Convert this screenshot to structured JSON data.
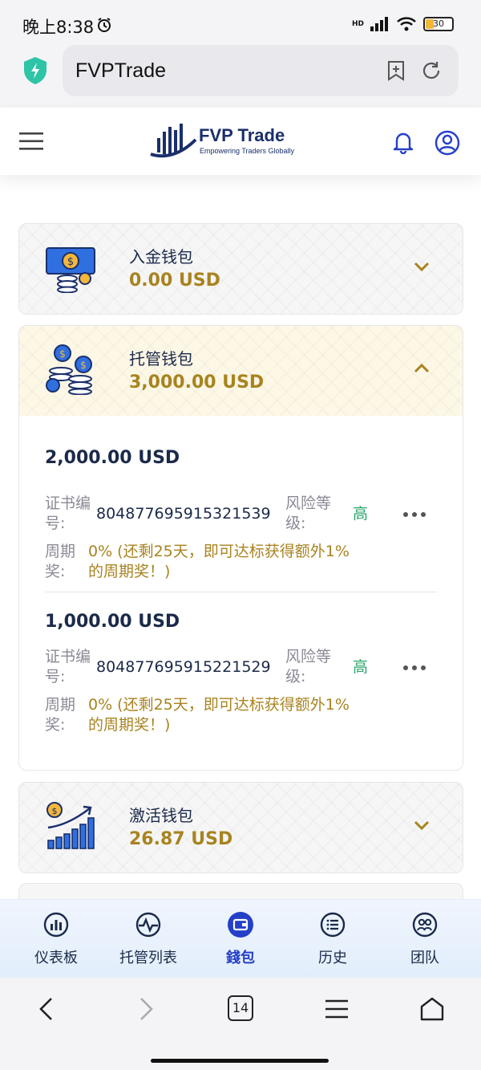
{
  "status_bar": {
    "time": "晚上8:38",
    "network": "HD",
    "battery": "30"
  },
  "browser": {
    "url": "FVPTrade",
    "tab_count": "14"
  },
  "header": {
    "brand": "FVP Trade",
    "tagline": "Empowering Traders Globally"
  },
  "wallets": [
    {
      "name": "入金钱包",
      "amount": "0.00 USD",
      "expanded": false
    },
    {
      "name": "托管钱包",
      "amount": "3,000.00 USD",
      "expanded": true,
      "entries": [
        {
          "amount": "2,000.00 USD",
          "cert_label": "证书编号:",
          "cert_value": "804877695915321539",
          "risk_label": "风险等级:",
          "risk_value": "高",
          "period_label": "周期奖:",
          "period_value": "0% (还剩25天，即可达标获得额外1%的周期奖！)"
        },
        {
          "amount": "1,000.00 USD",
          "cert_label": "证书编号:",
          "cert_value": "804877695915221529",
          "risk_label": "风险等级:",
          "risk_value": "高",
          "period_label": "周期奖:",
          "period_value": "0% (还剩25天，即可达标获得额外1%的周期奖！)"
        }
      ]
    },
    {
      "name": "激活钱包",
      "amount": "26.87 USD",
      "expanded": false
    }
  ],
  "app_nav": [
    {
      "label": "仪表板",
      "icon": "dashboard-icon"
    },
    {
      "label": "托管列表",
      "icon": "pulse-icon"
    },
    {
      "label": "錢包",
      "icon": "wallet-icon",
      "active": true
    },
    {
      "label": "历史",
      "icon": "list-icon"
    },
    {
      "label": "团队",
      "icon": "team-icon"
    }
  ],
  "colors": {
    "accent": "#2540c8",
    "gold": "#a8831f",
    "navy": "#1b2a4a",
    "risk_high": "#2aa56a"
  }
}
